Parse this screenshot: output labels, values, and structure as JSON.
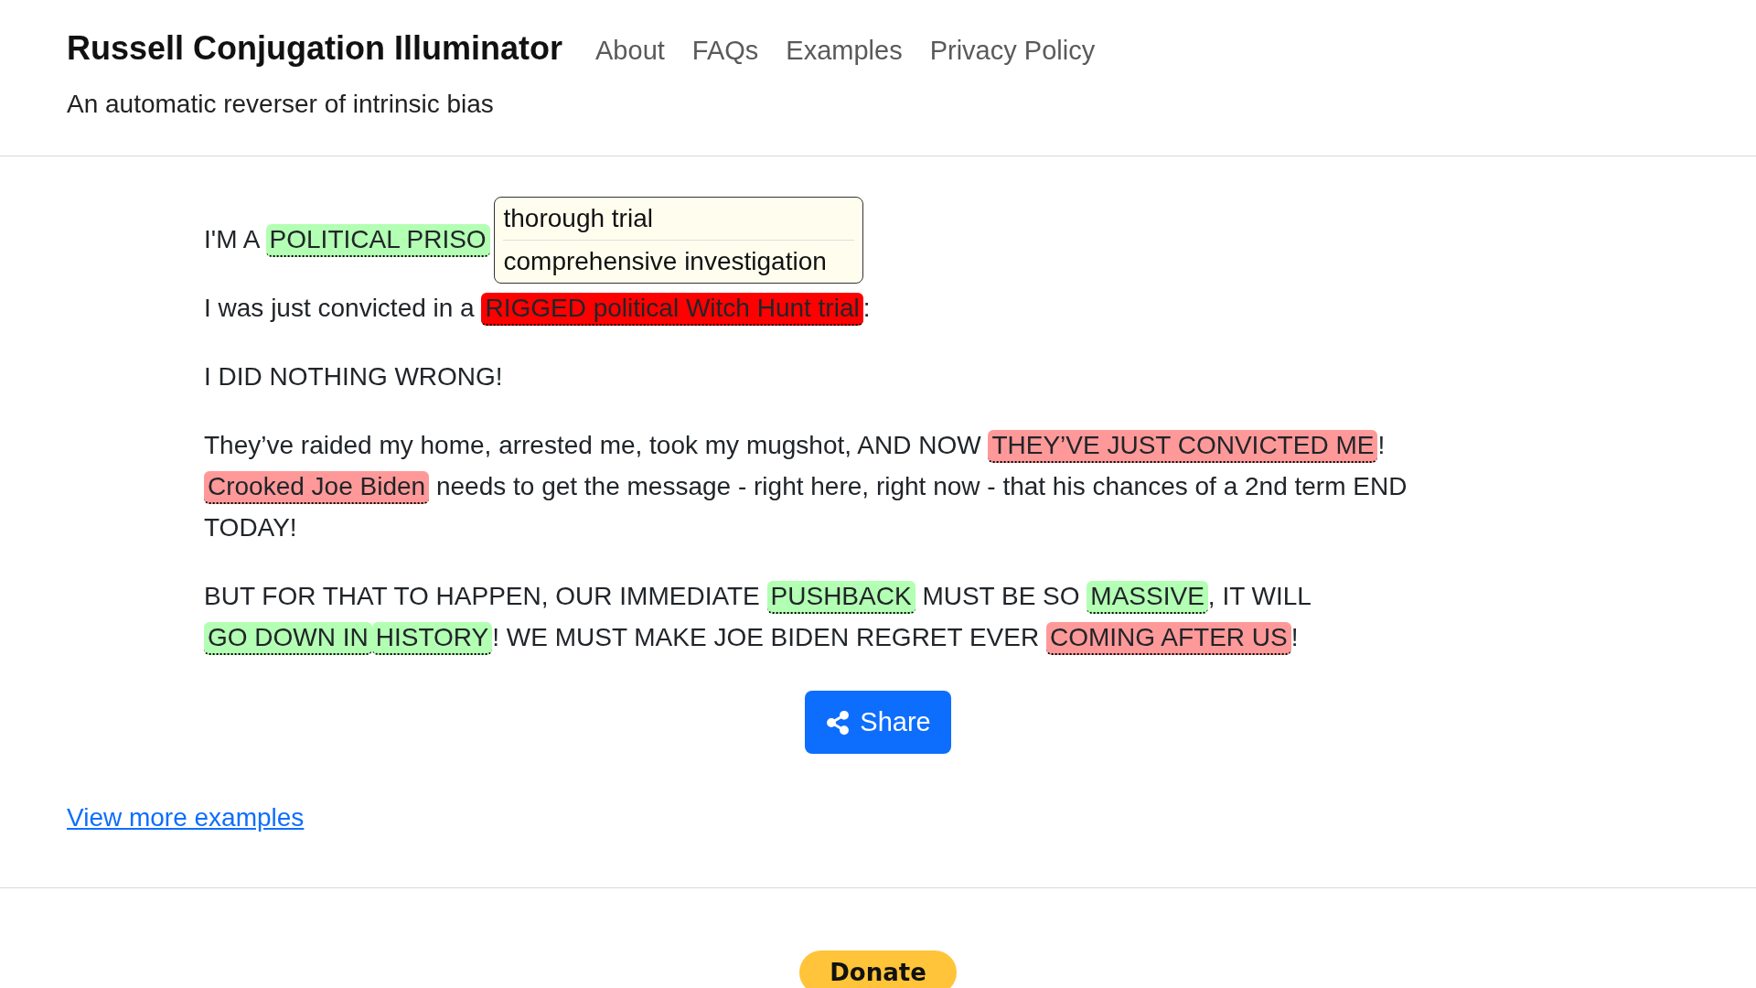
{
  "header": {
    "title": "Russell Conjugation Illuminator",
    "nav": [
      "About",
      "FAQs",
      "Examples",
      "Privacy Policy"
    ],
    "subtitle": "An automatic reverser of intrinsic bias"
  },
  "paragraphs": [
    {
      "segments": [
        {
          "kind": "plain",
          "text": "I'M A "
        },
        {
          "kind": "highlight",
          "text": "POLITICAL PRISO",
          "color": "#b3ffb3"
        }
      ]
    },
    {
      "segments": [
        {
          "kind": "plain",
          "text": "I was just convicted in a "
        },
        {
          "kind": "highlight",
          "text": "RIGGED political Witch Hunt trial",
          "color": "#ff0000",
          "alternatives": [
            "thorough trial",
            "comprehensive investigation"
          ]
        },
        {
          "kind": "plain",
          "text": ":"
        }
      ]
    },
    {
      "segments": [
        {
          "kind": "plain",
          "text": "I DID NOTHING WRONG!"
        }
      ]
    },
    {
      "segments": [
        {
          "kind": "plain",
          "text": "They’ve raided my home, arrested me, took my mugshot, AND NOW "
        },
        {
          "kind": "highlight",
          "text": "THEY’VE JUST CONVICTED ME",
          "color": "#ff9999"
        },
        {
          "kind": "plain",
          "text": "! "
        },
        {
          "kind": "highlight",
          "text": "Crooked Joe Biden",
          "color": "#ff9999"
        },
        {
          "kind": "plain",
          "text": " needs to get the message - right here, right now - that his chances of a 2nd term END TODAY!"
        }
      ]
    },
    {
      "segments": [
        {
          "kind": "plain",
          "text": "BUT FOR THAT TO HAPPEN, OUR IMMEDIATE "
        },
        {
          "kind": "highlight",
          "text": "PUSHBACK",
          "color": "#b3ffb3"
        },
        {
          "kind": "plain",
          "text": " MUST BE SO "
        },
        {
          "kind": "highlight",
          "text": "MASSIVE",
          "color": "#b3ffb3"
        },
        {
          "kind": "plain",
          "text": ", IT WILL "
        },
        {
          "kind": "highlight",
          "text": "GO DOWN IN",
          "color": "#b3ffb3"
        },
        {
          "kind": "highlight",
          "text": "HISTORY",
          "color": "#b3ffb3"
        },
        {
          "kind": "plain",
          "text": "! WE MUST MAKE JOE BIDEN REGRET EVER "
        },
        {
          "kind": "highlight",
          "text": "COMING AFTER US",
          "color": "#ff9999"
        },
        {
          "kind": "plain",
          "text": "!"
        }
      ]
    }
  ],
  "share_button": "Share",
  "more_link": "View more examples",
  "donate_button": "Donate"
}
